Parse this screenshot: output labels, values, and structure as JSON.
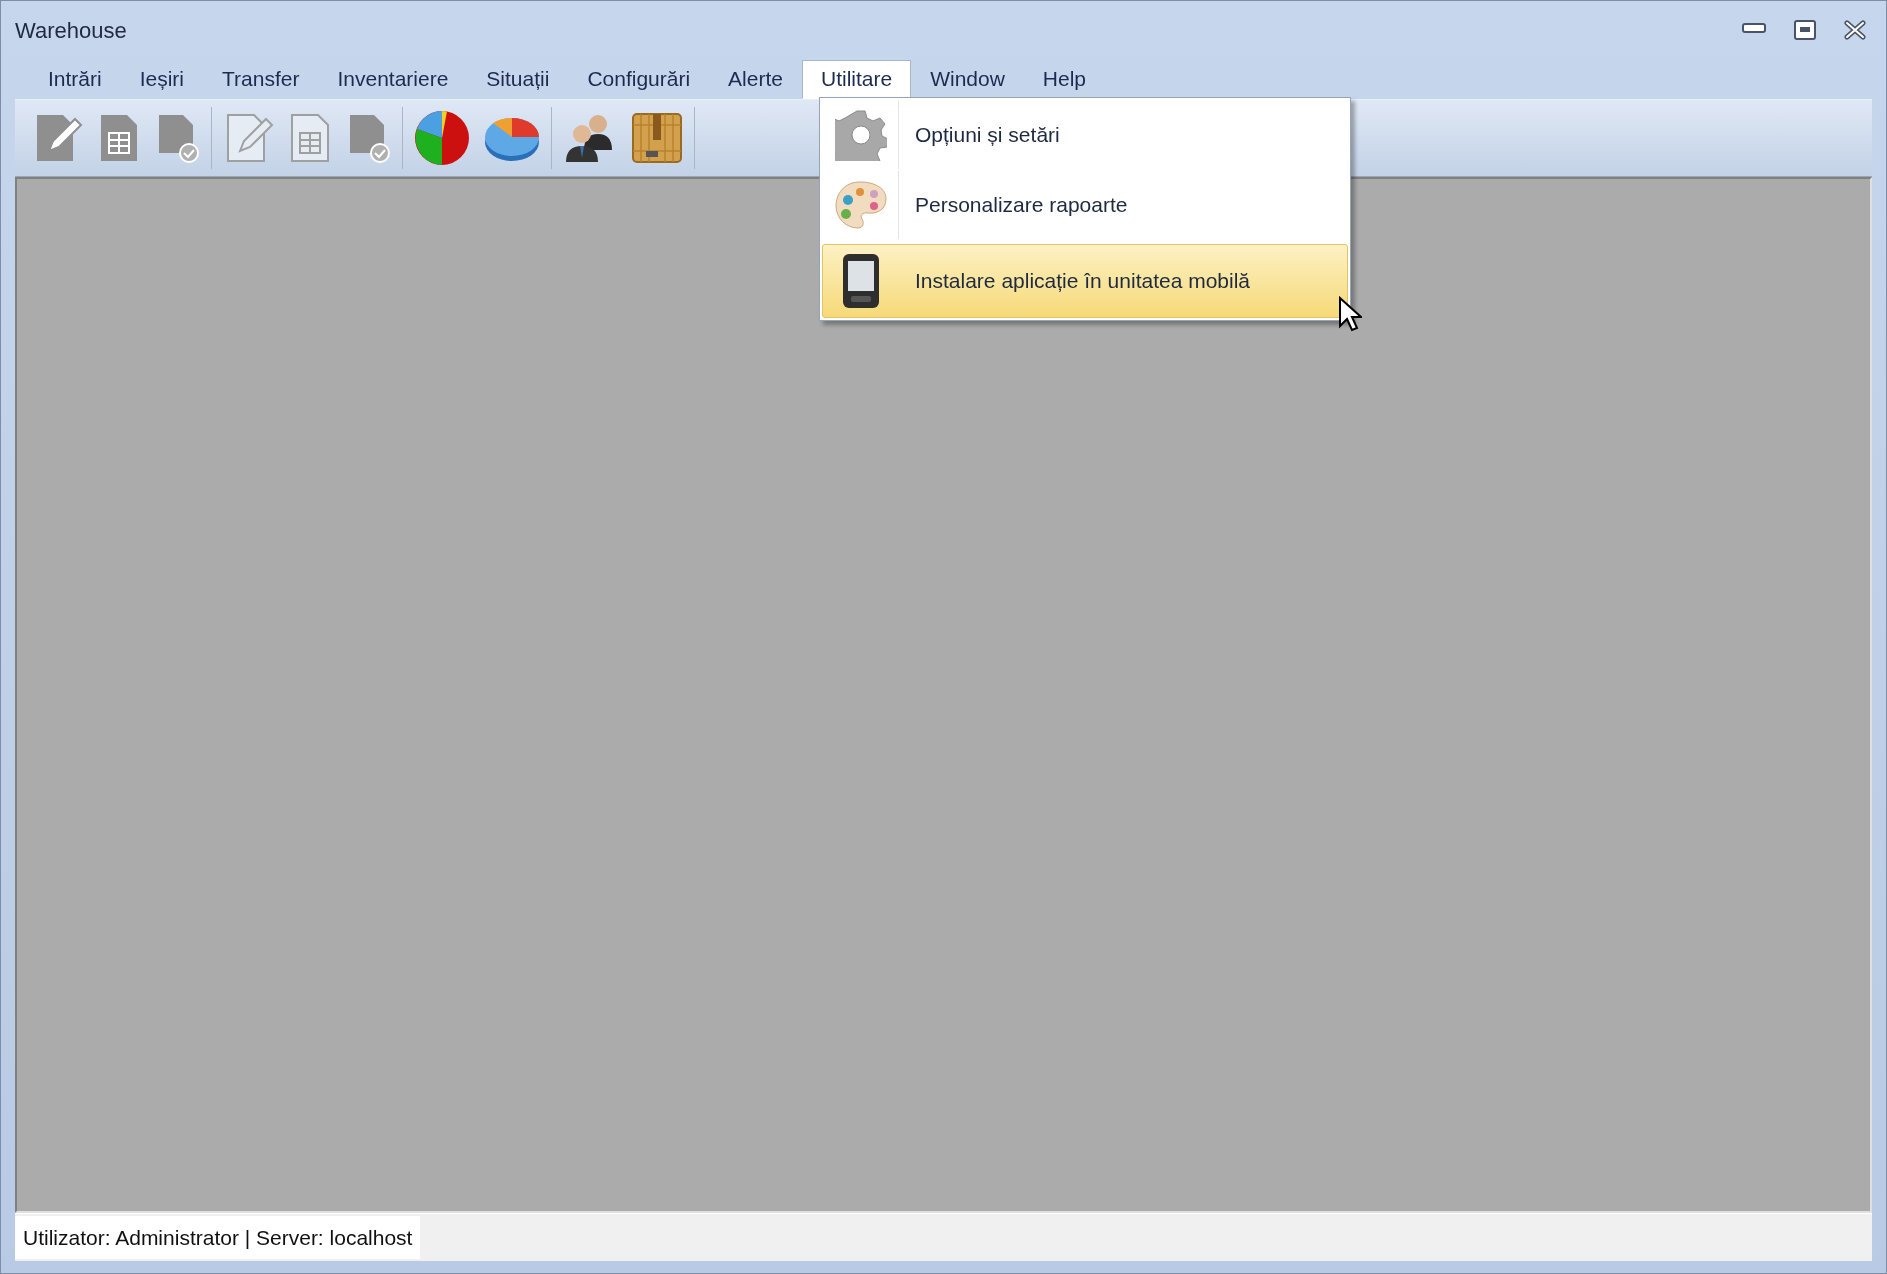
{
  "window": {
    "title": "Warehouse"
  },
  "menu_bar": [
    {
      "label": "Intrări",
      "selected": false
    },
    {
      "label": "Ieșiri",
      "selected": false
    },
    {
      "label": "Transfer",
      "selected": false
    },
    {
      "label": "Inventariere",
      "selected": false
    },
    {
      "label": "Situații",
      "selected": false
    },
    {
      "label": "Configurări",
      "selected": false
    },
    {
      "label": "Alerte",
      "selected": false
    },
    {
      "label": "Utilitare",
      "selected": true
    },
    {
      "label": "Window",
      "selected": false
    },
    {
      "label": "Help",
      "selected": false
    }
  ],
  "dropdown": {
    "items": [
      {
        "kind": "settings",
        "label": "Opțiuni și setări",
        "selected": false
      },
      {
        "kind": "palette",
        "label": "Personalizare rapoarte",
        "selected": false
      },
      {
        "kind": "device",
        "label": "Instalare aplicație în unitatea mobilă",
        "selected": true
      }
    ]
  },
  "status_bar": {
    "text": "Utilizator: Administrator | Server: localhost"
  }
}
